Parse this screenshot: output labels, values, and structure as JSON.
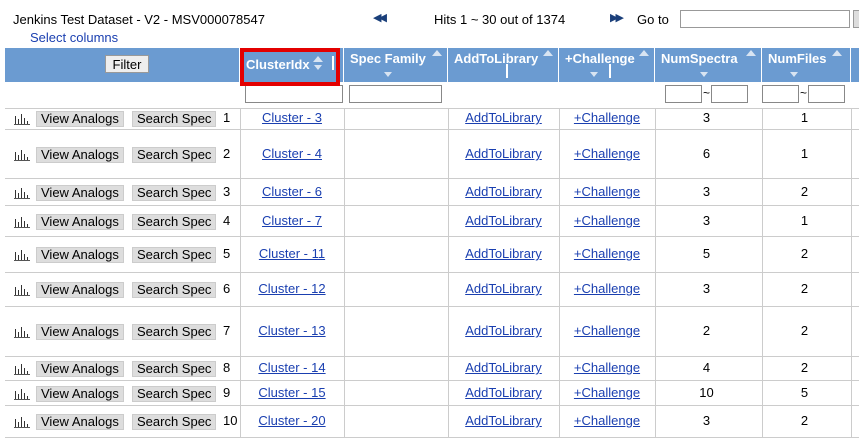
{
  "header": {
    "title": "Jenkins Test Dataset - V2 - MSV000078547",
    "select_columns": "Select columns",
    "hits": "Hits 1 ~ 30 out of 1374",
    "goto_label": "Go to"
  },
  "columns": {
    "filter": "Filter",
    "cluster": "ClusterIdx",
    "spec": "Spec Family",
    "addlib": "AddToLibrary",
    "challenge": "+Challenge",
    "numspectra": "NumSpectra",
    "numfiles": "NumFiles"
  },
  "rows": [
    {
      "idx": "1",
      "view": "View Analogs",
      "search": "Search Spec",
      "cluster": "Cluster - 3",
      "add": "AddToLibrary",
      "challenge": "+Challenge",
      "numspectra": "3",
      "numfiles": "1"
    },
    {
      "idx": "2",
      "view": "View Analogs",
      "search": "Search Spec",
      "cluster": "Cluster - 4",
      "add": "AddToLibrary",
      "challenge": "+Challenge",
      "numspectra": "6",
      "numfiles": "1"
    },
    {
      "idx": "3",
      "view": "View Analogs",
      "search": "Search Spec",
      "cluster": "Cluster - 6",
      "add": "AddToLibrary",
      "challenge": "+Challenge",
      "numspectra": "3",
      "numfiles": "2"
    },
    {
      "idx": "4",
      "view": "View Analogs",
      "search": "Search Spec",
      "cluster": "Cluster - 7",
      "add": "AddToLibrary",
      "challenge": "+Challenge",
      "numspectra": "3",
      "numfiles": "1"
    },
    {
      "idx": "5",
      "view": "View Analogs",
      "search": "Search Spec",
      "cluster": "Cluster - 11",
      "add": "AddToLibrary",
      "challenge": "+Challenge",
      "numspectra": "5",
      "numfiles": "2"
    },
    {
      "idx": "6",
      "view": "View Analogs",
      "search": "Search Spec",
      "cluster": "Cluster - 12",
      "add": "AddToLibrary",
      "challenge": "+Challenge",
      "numspectra": "3",
      "numfiles": "2"
    },
    {
      "idx": "7",
      "view": "View Analogs",
      "search": "Search Spec",
      "cluster": "Cluster - 13",
      "add": "AddToLibrary",
      "challenge": "+Challenge",
      "numspectra": "2",
      "numfiles": "2"
    },
    {
      "idx": "8",
      "view": "View Analogs",
      "search": "Search Spec",
      "cluster": "Cluster - 14",
      "add": "AddToLibrary",
      "challenge": "+Challenge",
      "numspectra": "4",
      "numfiles": "2"
    },
    {
      "idx": "9",
      "view": "View Analogs",
      "search": "Search Spec",
      "cluster": "Cluster - 15",
      "add": "AddToLibrary",
      "challenge": "+Challenge",
      "numspectra": "10",
      "numfiles": "5"
    },
    {
      "idx": "10",
      "view": "View Analogs",
      "search": "Search Spec",
      "cluster": "Cluster - 20",
      "add": "AddToLibrary",
      "challenge": "+Challenge",
      "numspectra": "3",
      "numfiles": "2"
    }
  ]
}
